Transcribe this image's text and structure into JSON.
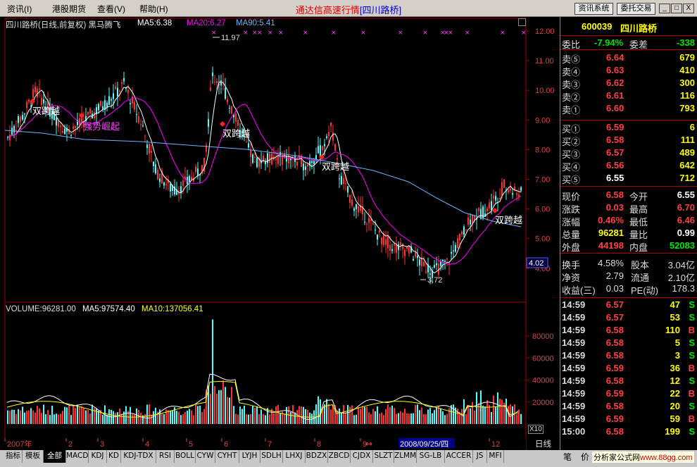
{
  "menu": [
    "资讯",
    "港股期货",
    "查看",
    "帮助"
  ],
  "menu_keys": [
    "(I)",
    "",
    "(V)",
    "(H)"
  ],
  "title": {
    "main": "通达信高速行情",
    "stock": "[四川路桥]"
  },
  "top_buttons": [
    "资讯系统",
    "委托交易"
  ],
  "win_buttons": [
    "_",
    "□",
    "X"
  ],
  "kline": {
    "header": "四川路桥(日线,前复权) 黑马腾飞",
    "ma5": "MA5:6.38",
    "ma20": "MA20:6.27",
    "ma90": "MA90:5.41",
    "y_labels": [
      "12.00",
      "11.00",
      "10.00",
      "9.00",
      "8.00",
      "7.00",
      "6.00",
      "5.00",
      "4.00"
    ],
    "y_values": [
      12,
      11,
      10,
      9,
      8,
      7,
      6,
      5,
      4
    ],
    "current_price_tag": "4.02",
    "high_label": "11.97",
    "low_label": "3.72",
    "signals": [
      "双跨越",
      "双跨越",
      "双跨越",
      "双跨越",
      "双跨越"
    ],
    "signal_mid": "双跨越",
    "signal_rise": "强势崛起"
  },
  "volume": {
    "header": "VOLUME:96281.00",
    "ma5": "MA5:97574.40",
    "ma10": "MA10:137056.41",
    "y_labels": [
      "80000",
      "60000",
      "40000",
      "20000"
    ],
    "unit": "X10"
  },
  "months": [
    "2007年",
    "2",
    "3",
    "4",
    "5",
    "6",
    "7",
    "8",
    "9",
    "12"
  ],
  "cursor_date": "2008/09/25/四",
  "period": "日线",
  "tabs": [
    "指标",
    "模板",
    "全部",
    "MACD",
    "KDJ",
    "KD",
    "KDJ-TDX",
    "RSI",
    "BOLL",
    "CYW",
    "CYHT",
    "LYJH",
    "SDLH",
    "LHXJ",
    "BDZX",
    "ZBCD",
    "CJDX",
    "SLZT",
    "ZLMM",
    "SG-LB",
    "ACCER",
    "JS",
    "MFI"
  ],
  "right_tabs": [
    "笔",
    "价",
    "分析家公式网"
  ],
  "watermark": "www.88gg.com",
  "quote": {
    "code": "600039",
    "name": "四川路桥",
    "weibi_label": "委比",
    "weibi": "-7.94%",
    "weicha_label": "委差",
    "weicha": "-338",
    "sells": [
      {
        "label": "卖⑤",
        "price": "6.64",
        "vol": "679"
      },
      {
        "label": "卖④",
        "price": "6.63",
        "vol": "410"
      },
      {
        "label": "卖③",
        "price": "6.62",
        "vol": "300"
      },
      {
        "label": "卖②",
        "price": "6.61",
        "vol": "116"
      },
      {
        "label": "卖①",
        "price": "6.60",
        "vol": "793"
      }
    ],
    "buys": [
      {
        "label": "买①",
        "price": "6.59",
        "vol": "6"
      },
      {
        "label": "买②",
        "price": "6.58",
        "vol": "111"
      },
      {
        "label": "买③",
        "price": "6.57",
        "vol": "489"
      },
      {
        "label": "买④",
        "price": "6.56",
        "vol": "642"
      },
      {
        "label": "买⑤",
        "price": "6.55",
        "vol": "712"
      }
    ],
    "stats": [
      [
        "现价",
        "6.58",
        "今开",
        "6.55"
      ],
      [
        "涨跌",
        "0.03",
        "最高",
        "6.70"
      ],
      [
        "涨幅",
        "0.46%",
        "最低",
        "6.46"
      ],
      [
        "总量",
        "96281",
        "量比",
        "0.99"
      ],
      [
        "外盘",
        "44198",
        "内盘",
        "52083"
      ]
    ],
    "fund": [
      [
        "换手",
        "4.58%",
        "股本",
        "3.04亿"
      ],
      [
        "净资",
        "2.79",
        "流通",
        "2.10亿"
      ],
      [
        "收益(三)",
        "0.03",
        "PE(动)",
        "178.3"
      ]
    ],
    "ticks": [
      [
        "14:59",
        "6.57",
        "47",
        "S"
      ],
      [
        "14:59",
        "6.57",
        "53",
        "S"
      ],
      [
        "14:59",
        "6.58",
        "110",
        "B"
      ],
      [
        "14:59",
        "6.58",
        "5",
        "S"
      ],
      [
        "14:59",
        "6.58",
        "3",
        "S"
      ],
      [
        "14:59",
        "6.59",
        "36",
        "B"
      ],
      [
        "14:59",
        "6.58",
        "12",
        "S"
      ],
      [
        "14:59",
        "6.59",
        "22",
        "B"
      ],
      [
        "14:59",
        "6.58",
        "20",
        "S"
      ],
      [
        "14:59",
        "6.59",
        "59",
        "B"
      ],
      [
        "15:00",
        "6.58",
        "199",
        "S"
      ]
    ]
  },
  "colors": {
    "up": "#ff3232",
    "down": "#54fcfc",
    "ma5": "#ffffff",
    "ma20": "#ff00ff",
    "ma90": "#6ab4ff",
    "yellow": "#ffff00",
    "green": "#00e600"
  }
}
